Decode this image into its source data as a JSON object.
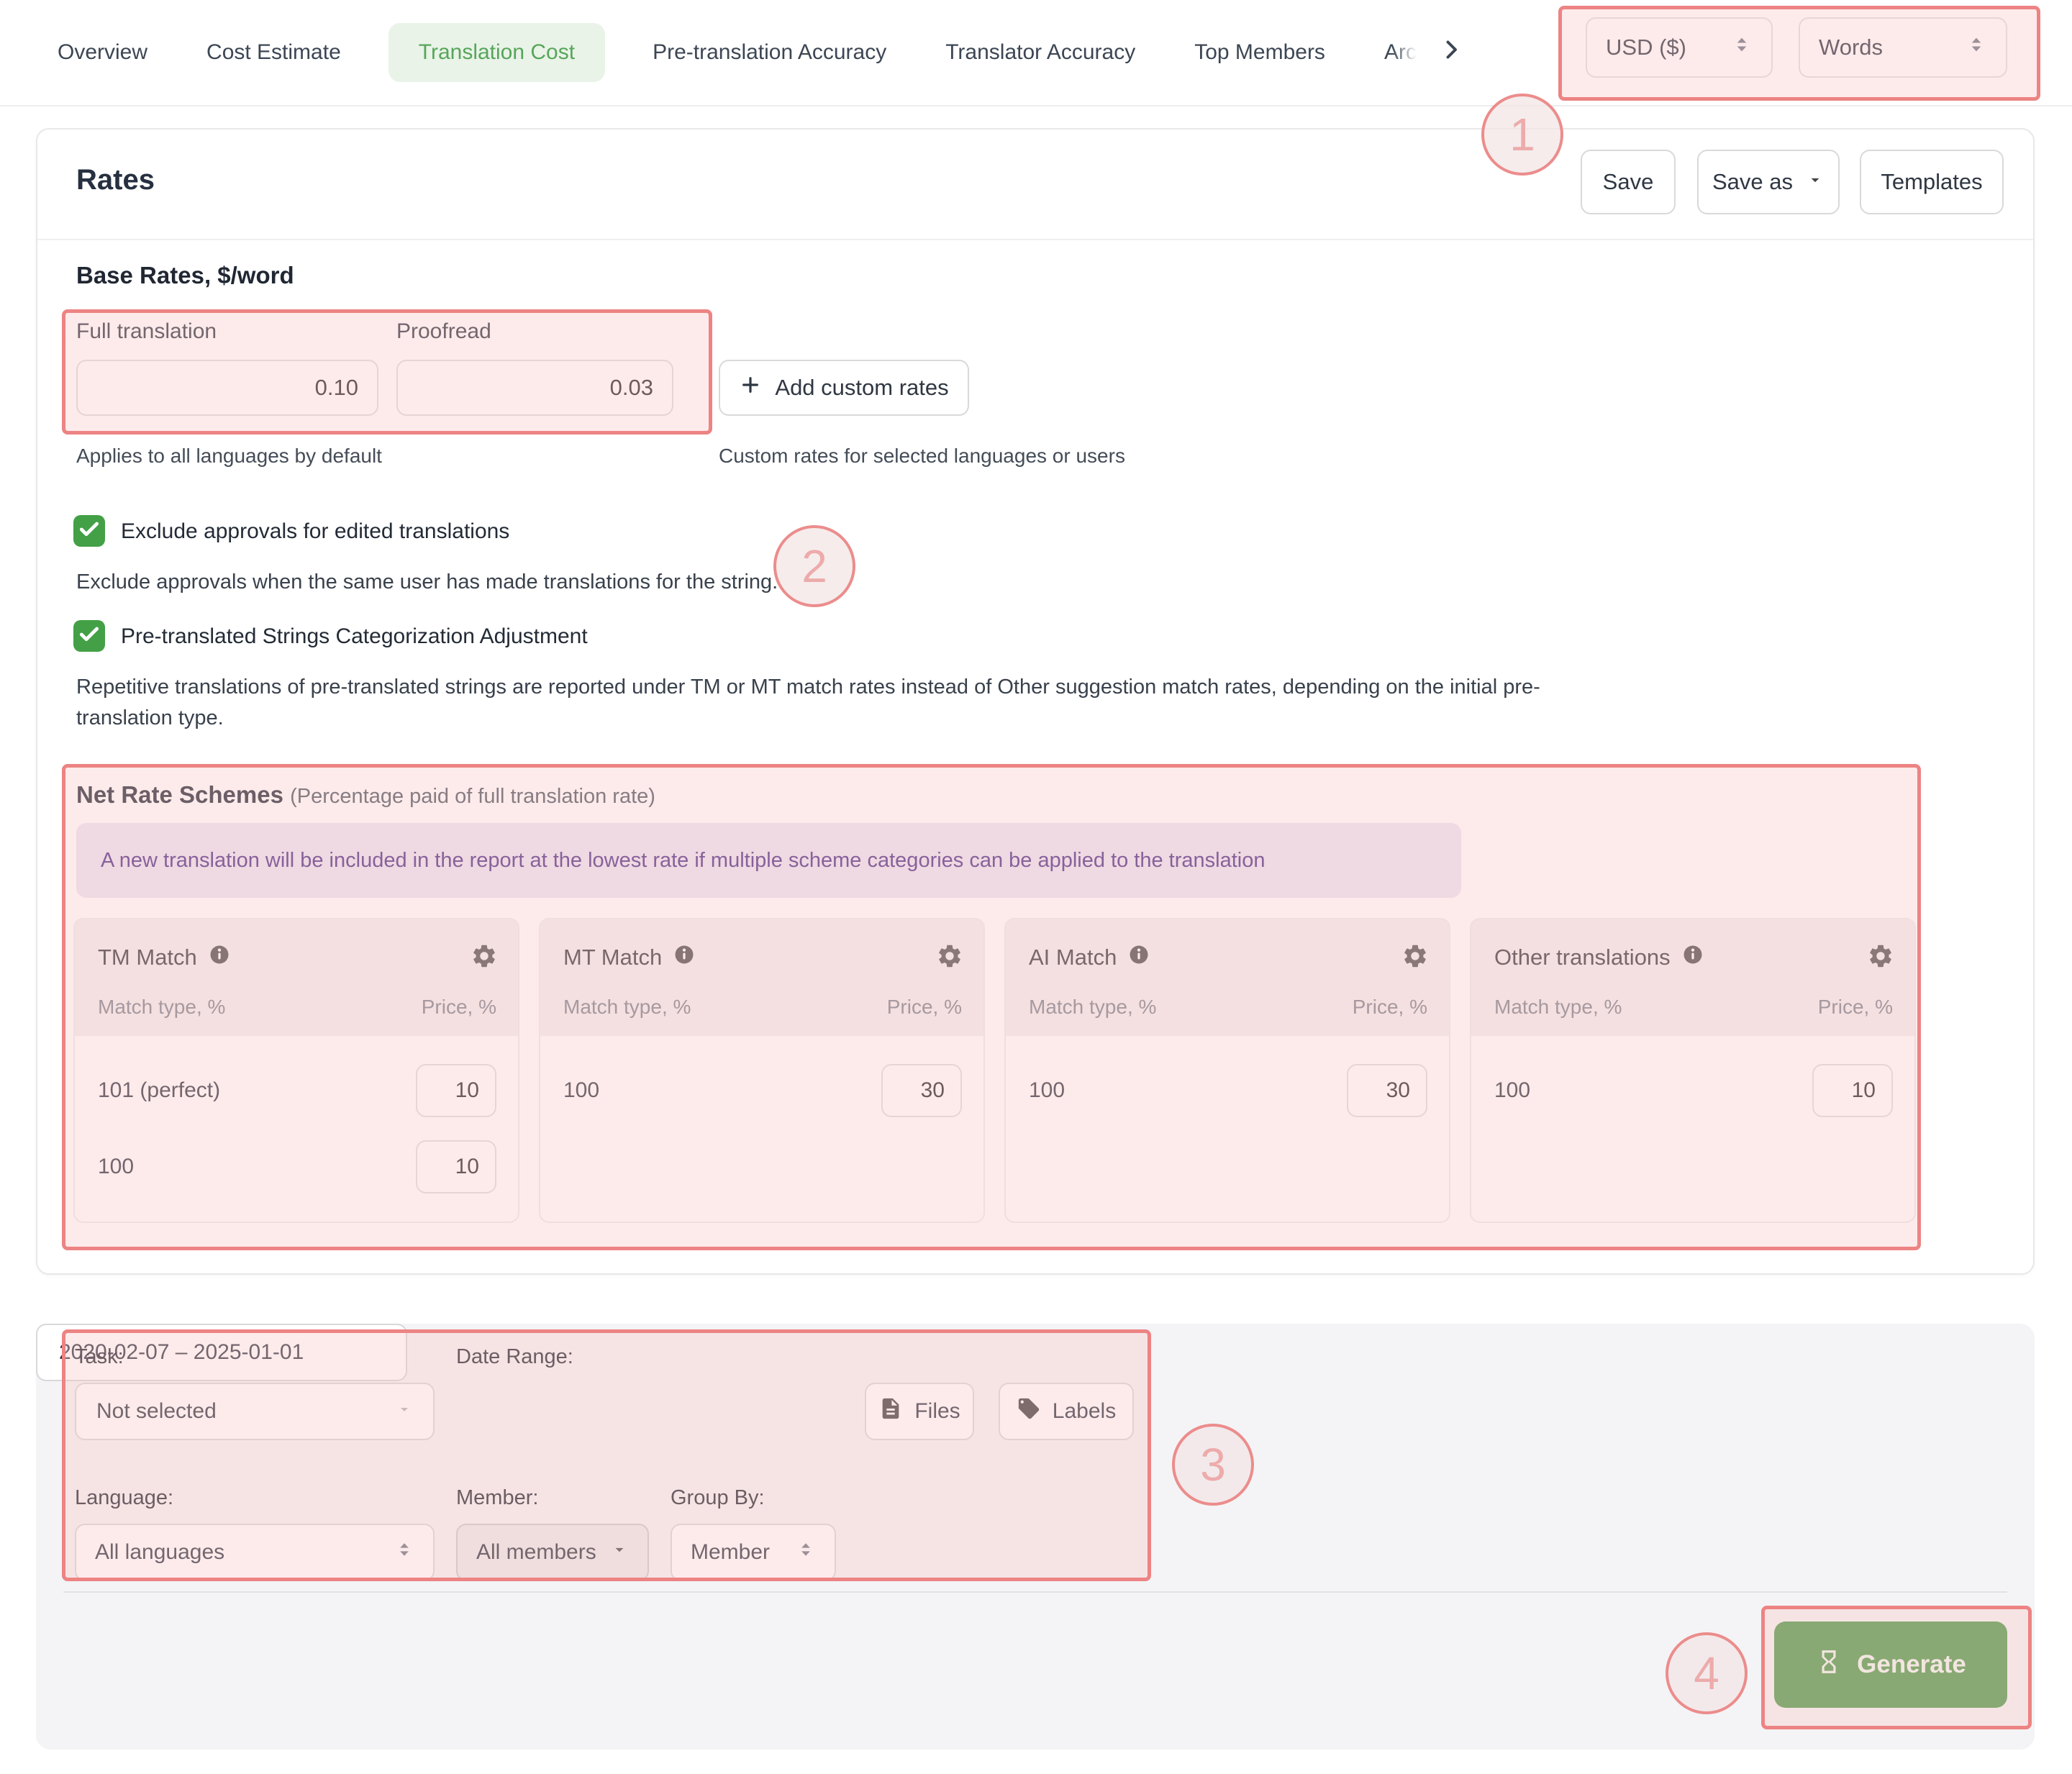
{
  "tabs": {
    "items": [
      {
        "label": "Overview",
        "active": false
      },
      {
        "label": "Cost Estimate",
        "active": false
      },
      {
        "label": "Translation Cost",
        "active": true
      },
      {
        "label": "Pre-translation Accuracy",
        "active": false
      },
      {
        "label": "Translator Accuracy",
        "active": false
      },
      {
        "label": "Top Members",
        "active": false
      },
      {
        "label": "Arc",
        "active": false,
        "truncated": true
      }
    ]
  },
  "top_controls": {
    "currency": "USD ($)",
    "unit": "Words"
  },
  "rates": {
    "title": "Rates",
    "save_label": "Save",
    "save_as_label": "Save as",
    "templates_label": "Templates"
  },
  "base_rates": {
    "heading": "Base Rates, $/word",
    "full_translation_label": "Full translation",
    "full_translation_value": "0.10",
    "proofread_label": "Proofread",
    "proofread_value": "0.03",
    "add_custom_label": "Add custom rates",
    "full_helper": "Applies to all languages by default",
    "custom_helper": "Custom rates for selected languages or users"
  },
  "options": [
    {
      "label": "Exclude approvals for edited translations",
      "description": "Exclude approvals when the same user has made translations for the string.",
      "checked": true
    },
    {
      "label": "Pre-translated Strings Categorization Adjustment",
      "description": "Repetitive translations of pre-translated strings are reported under TM or MT match rates instead of Other suggestion match rates, depending on the initial pre-translation type.",
      "checked": true
    }
  ],
  "net_rate_schemes": {
    "heading": "Net Rate Schemes",
    "subtitle": "(Percentage paid of full translation rate)",
    "notice": "A new translation will be included in the report at the lowest rate if multiple scheme categories can be applied to the translation",
    "col_match": "Match type, %",
    "col_price": "Price, %",
    "cards": [
      {
        "title": "TM Match",
        "rows": [
          {
            "match": "101 (perfect)",
            "price": "10"
          },
          {
            "match": "100",
            "price": "10"
          }
        ]
      },
      {
        "title": "MT Match",
        "rows": [
          {
            "match": "100",
            "price": "30"
          }
        ]
      },
      {
        "title": "AI Match",
        "rows": [
          {
            "match": "100",
            "price": "30"
          }
        ]
      },
      {
        "title": "Other translations",
        "rows": [
          {
            "match": "100",
            "price": "10"
          }
        ]
      }
    ]
  },
  "filters": {
    "task_label": "Task:",
    "task_value": "Not selected",
    "date_label": "Date Range:",
    "date_value": "2020-02-07 – 2025-01-01",
    "files_label": "Files",
    "labels_label": "Labels",
    "language_label": "Language:",
    "language_value": "All languages",
    "member_label": "Member:",
    "member_value": "All members",
    "group_label": "Group By:",
    "group_value": "Member"
  },
  "generate": {
    "label": "Generate"
  },
  "annotations": {
    "step1": "1",
    "step2": "2",
    "step3": "3",
    "step4": "4"
  },
  "colors": {
    "accent_green": "#43a047",
    "active_tab_bg": "#e9f3e8",
    "active_tab_text": "#57a65a",
    "generate_green": "#4c9a47",
    "annotation_red": "#ed8383",
    "notice_bg": "#eae3f2",
    "notice_text": "#4a2b85"
  }
}
